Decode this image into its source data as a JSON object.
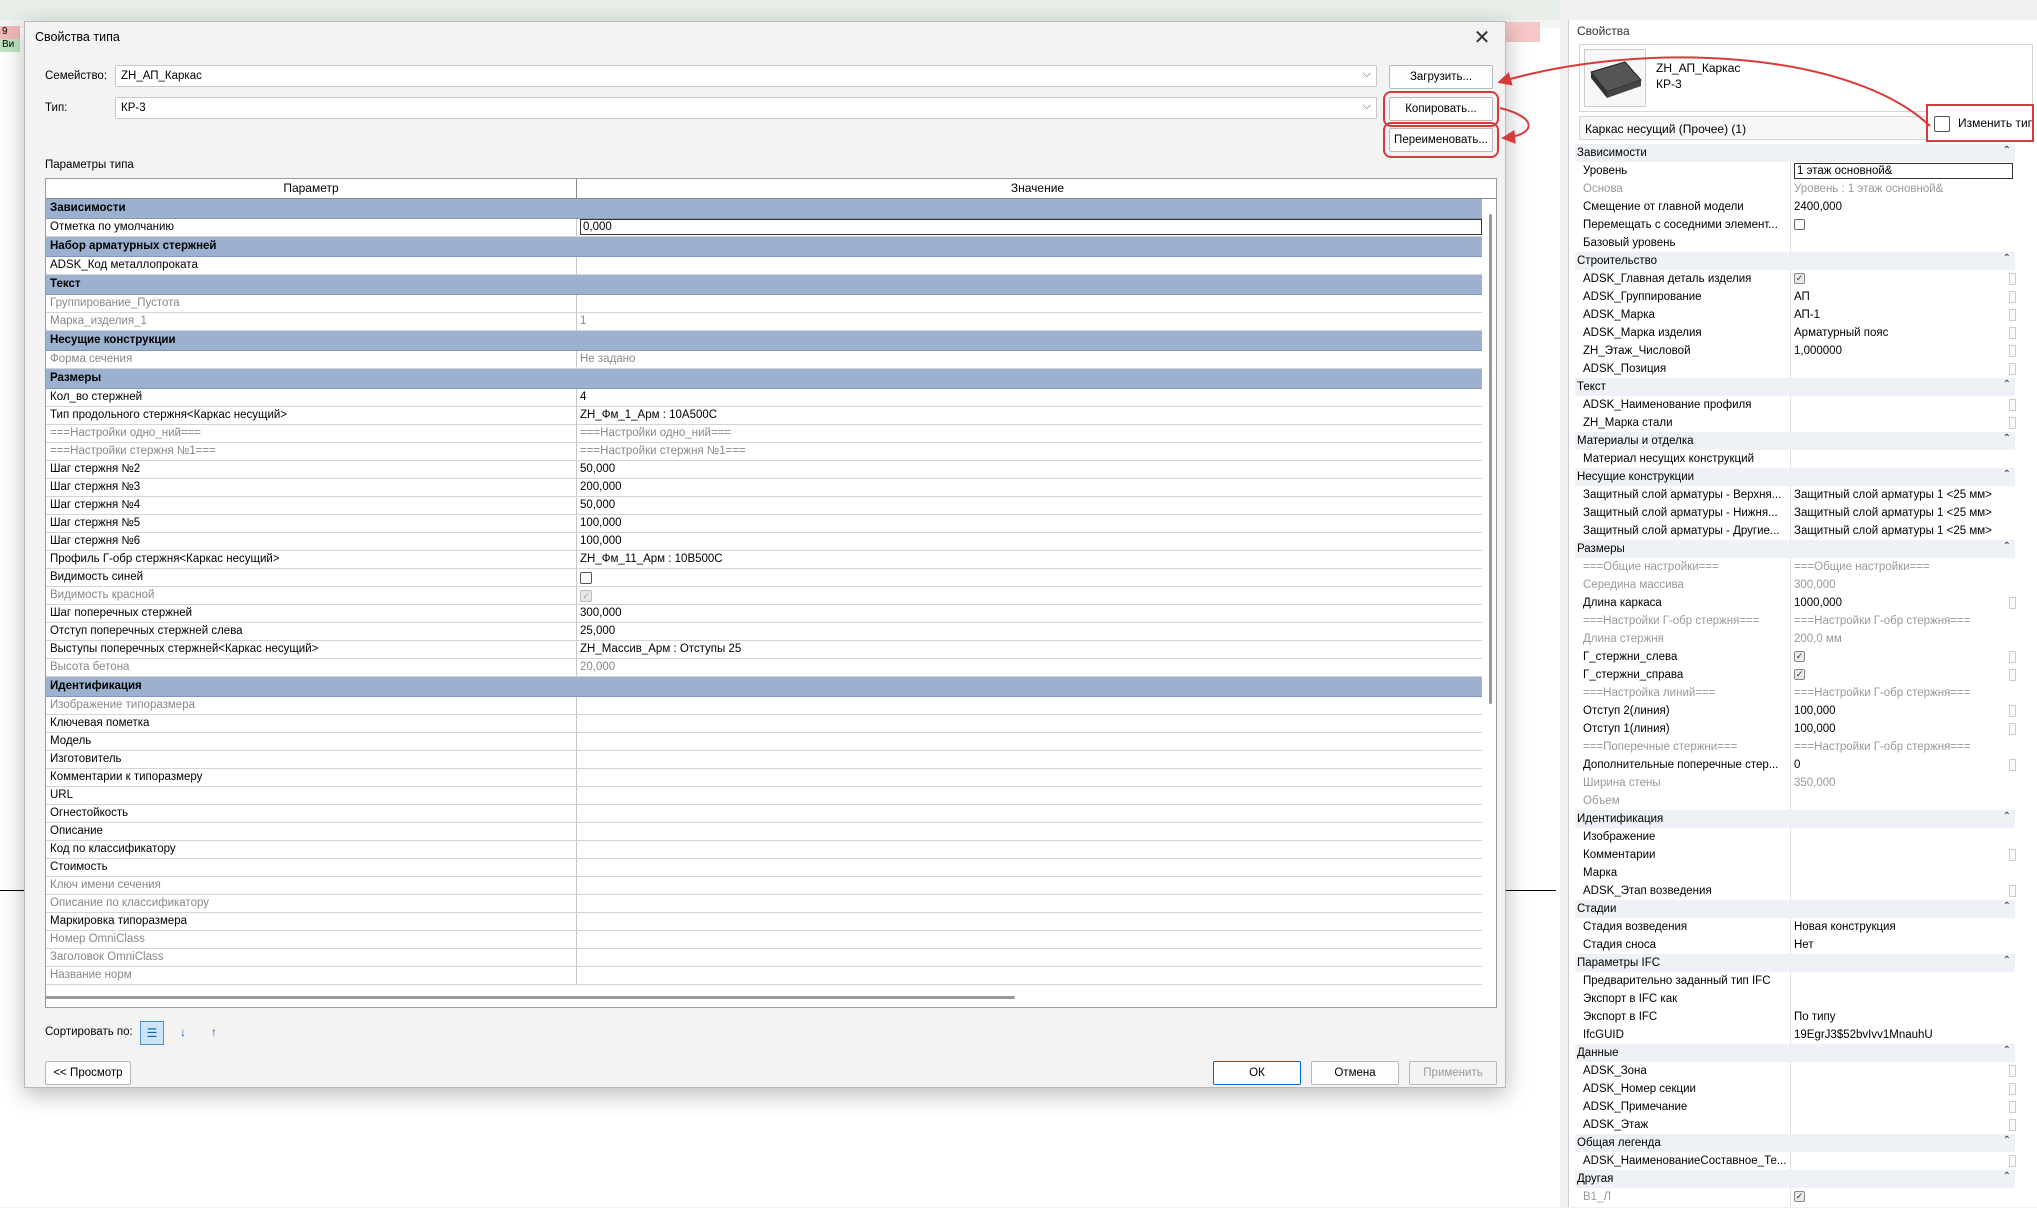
{
  "background": {
    "tag_top": "9",
    "tag_bottom": "Ви"
  },
  "dialog": {
    "title": "Свойства типа",
    "family_label": "Семейство:",
    "family_value": "ZH_АП_Каркас",
    "type_label": "Тип:",
    "type_value": "КР-3",
    "load_button": "Загрузить...",
    "copy_button": "Копировать...",
    "rename_button": "Переименовать...",
    "type_params_label": "Параметры типа",
    "col_param": "Параметр",
    "col_value": "Значение",
    "rows": [
      {
        "g": "Зависимости"
      },
      {
        "n": "Отметка по умолчанию",
        "v": "0,000",
        "input": true
      },
      {
        "g": "Набор арматурных стержней"
      },
      {
        "n": "ADSK_Код металлопроката",
        "v": ""
      },
      {
        "g": "Текст"
      },
      {
        "n": "Группирование_Пустота",
        "v": "",
        "dim": true
      },
      {
        "n": "Марка_изделия_1",
        "v": "1",
        "dim": true
      },
      {
        "g": "Несущие конструкции"
      },
      {
        "n": "Форма сечения",
        "v": "Не задано",
        "dim": true
      },
      {
        "g": "Размеры"
      },
      {
        "n": "Кол_во стержней",
        "v": "4"
      },
      {
        "n": "Тип продольного стержня<Каркас несущий>",
        "v": "ZH_Фм_1_Арм : 10А500С"
      },
      {
        "n": "===Настройки одно_ний===",
        "v": "===Настройки одно_ний===",
        "dim": true
      },
      {
        "n": "===Настройки стержня №1===",
        "v": "===Настройки стержня №1===",
        "dim": true
      },
      {
        "n": "Шаг стержня №2",
        "v": "50,000"
      },
      {
        "n": "Шаг стержня №3",
        "v": "200,000"
      },
      {
        "n": "Шаг стержня №4",
        "v": "50,000"
      },
      {
        "n": "Шаг стержня №5",
        "v": "100,000"
      },
      {
        "n": "Шаг стержня №6",
        "v": "100,000"
      },
      {
        "n": "Профиль Г-обр стержня<Каркас несущий>",
        "v": "ZH_Фм_11_Арм : 10В500С"
      },
      {
        "n": "Видимость синей",
        "v": "",
        "chk": "off"
      },
      {
        "n": "Видимость красной",
        "v": "",
        "chk": "dis",
        "dim": true
      },
      {
        "n": "Шаг поперечных стержней",
        "v": "300,000"
      },
      {
        "n": "Отступ поперечных стержней слева",
        "v": "25,000"
      },
      {
        "n": "Выступы поперечных стержней<Каркас несущий>",
        "v": "ZH_Массив_Арм : Отступы 25"
      },
      {
        "n": "Высота бетона",
        "v": "20,000",
        "dim": true
      },
      {
        "g": "Идентификация"
      },
      {
        "n": "Изображение типоразмера",
        "v": "",
        "dim": true
      },
      {
        "n": "Ключевая пометка",
        "v": ""
      },
      {
        "n": "Модель",
        "v": ""
      },
      {
        "n": "Изготовитель",
        "v": ""
      },
      {
        "n": "Комментарии к типоразмеру",
        "v": ""
      },
      {
        "n": "URL",
        "v": ""
      },
      {
        "n": "Огнестойкость",
        "v": ""
      },
      {
        "n": "Описание",
        "v": ""
      },
      {
        "n": "Код по классификатору",
        "v": ""
      },
      {
        "n": "Стоимость",
        "v": ""
      },
      {
        "n": "Ключ имени сечения",
        "v": "",
        "dim": true
      },
      {
        "n": "Описание по классификатору",
        "v": "",
        "dim": true
      },
      {
        "n": "Маркировка типоразмера",
        "v": ""
      },
      {
        "n": "Номер OmniClass",
        "v": "",
        "dim": true
      },
      {
        "n": "Заголовок OmniClass",
        "v": "",
        "dim": true
      },
      {
        "n": "Название норм",
        "v": "",
        "dim": true
      }
    ],
    "sort_label": "Сортировать по:",
    "preview_button": "<< Просмотр",
    "ok_button": "ОК",
    "cancel_button": "Отмена",
    "apply_button": "Применить"
  },
  "properties": {
    "title": "Свойства",
    "family": "ZH_АП_Каркас",
    "type": "КР-3",
    "selection": "Каркас несущий (Прочее) (1)",
    "edit_type_button": "Изменить тип",
    "rows": [
      {
        "g": "Зависимости"
      },
      {
        "n": "Уровень",
        "v": "1 этаж основной&",
        "box": true
      },
      {
        "n": "Основа",
        "v": "Уровень : 1 этаж основной&",
        "dim": true
      },
      {
        "n": "Смещение от главной модели",
        "v": "2400,000"
      },
      {
        "n": "Перемещать с соседними элемент...",
        "v": "",
        "chk": "off"
      },
      {
        "n": "Базовый уровень",
        "v": ""
      },
      {
        "g": "Строительство"
      },
      {
        "n": "ADSK_Главная деталь изделия",
        "v": "",
        "chk": "on",
        "side": true
      },
      {
        "n": "ADSK_Группирование",
        "v": "АП",
        "side": true
      },
      {
        "n": "ADSK_Марка",
        "v": "АП-1",
        "side": true
      },
      {
        "n": "ADSK_Марка изделия",
        "v": "Арматурный пояс",
        "side": true
      },
      {
        "n": "ZH_Этаж_Числовой",
        "v": "1,000000",
        "side": true
      },
      {
        "n": "ADSK_Позиция",
        "v": "",
        "side": true
      },
      {
        "g": "Текст"
      },
      {
        "n": "ADSK_Наименование профиля",
        "v": "",
        "side": true
      },
      {
        "n": "ZH_Марка стали",
        "v": "",
        "side": true
      },
      {
        "g": "Материалы и отделка"
      },
      {
        "n": "Материал несущих конструкций",
        "v": ""
      },
      {
        "g": "Несущие конструкции"
      },
      {
        "n": "Защитный слой арматуры - Верхня...",
        "v": "Защитный слой арматуры 1 <25 мм>"
      },
      {
        "n": "Защитный слой арматуры - Нижня...",
        "v": "Защитный слой арматуры 1 <25 мм>"
      },
      {
        "n": "Защитный слой арматуры - Другие...",
        "v": "Защитный слой арматуры 1 <25 мм>"
      },
      {
        "g": "Размеры"
      },
      {
        "n": "===Общие настройки===",
        "v": "===Общие настройки===",
        "dim": true
      },
      {
        "n": "Середина массива",
        "v": "300,000",
        "dim": true
      },
      {
        "n": "Длина каркаса",
        "v": "1000,000",
        "side": true
      },
      {
        "n": "===Настройки Г-обр стержня===",
        "v": "===Настройки Г-обр стержня===",
        "dim": true
      },
      {
        "n": "Длина стержня",
        "v": "200,0 мм",
        "dim": true
      },
      {
        "n": "Г_стержни_слева",
        "v": "",
        "chk": "on",
        "side": true
      },
      {
        "n": "Г_стержни_справа",
        "v": "",
        "chk": "on",
        "side": true
      },
      {
        "n": "===Настройка линий===",
        "v": "===Настройки Г-обр стержня===",
        "dim": true
      },
      {
        "n": "Отступ 2(линия)",
        "v": "100,000",
        "side": true
      },
      {
        "n": "Отступ 1(линия)",
        "v": "100,000",
        "side": true
      },
      {
        "n": "===Поперечные стержни===",
        "v": "===Настройки Г-обр стержня===",
        "dim": true
      },
      {
        "n": "Дополнительные поперечные стер...",
        "v": "0",
        "side": true
      },
      {
        "n": "Ширина стены",
        "v": "350,000",
        "dim": true
      },
      {
        "n": "Объем",
        "v": "",
        "dim": true
      },
      {
        "g": "Идентификация"
      },
      {
        "n": "Изображение",
        "v": ""
      },
      {
        "n": "Комментарии",
        "v": "",
        "side": true
      },
      {
        "n": "Марка",
        "v": ""
      },
      {
        "n": "ADSK_Этап возведения",
        "v": "",
        "side": true
      },
      {
        "g": "Стадии"
      },
      {
        "n": "Стадия возведения",
        "v": "Новая конструкция"
      },
      {
        "n": "Стадия сноса",
        "v": "Нет"
      },
      {
        "g": "Параметры IFC"
      },
      {
        "n": "Предварительно заданный тип IFC",
        "v": ""
      },
      {
        "n": "Экспорт в IFC как",
        "v": ""
      },
      {
        "n": "Экспорт в IFC",
        "v": "По типу"
      },
      {
        "n": "IfcGUID",
        "v": "19EgrJ3$52bvIvv1MnauhU"
      },
      {
        "g": "Данные"
      },
      {
        "n": "ADSK_Зона",
        "v": "",
        "side": true
      },
      {
        "n": "ADSK_Номер секции",
        "v": "",
        "side": true
      },
      {
        "n": "ADSK_Примечание",
        "v": "",
        "side": true
      },
      {
        "n": "ADSK_Этаж",
        "v": "",
        "side": true
      },
      {
        "g": "Общая легенда"
      },
      {
        "n": "ADSK_НаименованиеСоставное_Те...",
        "v": "",
        "side": true
      },
      {
        "g": "Другая"
      },
      {
        "n": "В1_Л",
        "v": "",
        "chk": "on",
        "dim": true
      }
    ]
  },
  "colors": {
    "group_row": "#9bb1cf",
    "highlight": "#d83a3a",
    "accent": "#0067c0"
  }
}
